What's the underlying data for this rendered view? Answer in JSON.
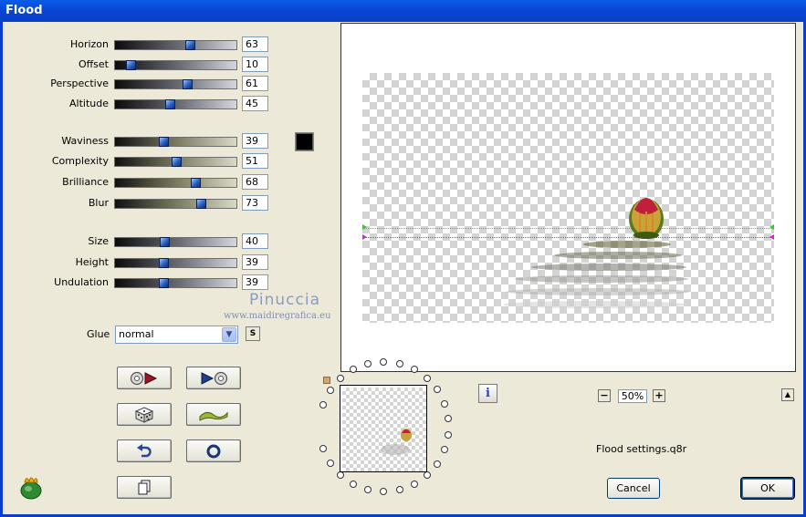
{
  "window": {
    "title": "Flood"
  },
  "sliders": [
    {
      "label": "Horizon",
      "value": 63
    },
    {
      "label": "Offset",
      "value": 10
    },
    {
      "label": "Perspective",
      "value": 61
    },
    {
      "label": "Altitude",
      "value": 45
    },
    {
      "label": "Waviness",
      "value": 39
    },
    {
      "label": "Complexity",
      "value": 51
    },
    {
      "label": "Brilliance",
      "value": 68
    },
    {
      "label": "Blur",
      "value": 73
    },
    {
      "label": "Size",
      "value": 40
    },
    {
      "label": "Height",
      "value": 39
    },
    {
      "label": "Undulation",
      "value": 39
    }
  ],
  "color_swatch": "#000000",
  "watermark": {
    "name": "Pinuccia",
    "url": "www.maidiregrafica.eu"
  },
  "glue": {
    "label": "Glue",
    "value": "normal"
  },
  "glue_side_button": "S",
  "tool_buttons": [
    {
      "icon": "random-left-icon"
    },
    {
      "icon": "random-right-icon"
    },
    {
      "icon": "dice-icon"
    },
    {
      "icon": "wave-icon"
    },
    {
      "icon": "undo-icon"
    },
    {
      "icon": "reset-icon"
    },
    {
      "icon": "copy-icon"
    }
  ],
  "info_button": "i",
  "zoom": {
    "minus": "−",
    "value": "50%",
    "plus": "+"
  },
  "expand_button": "▲",
  "settings_file": "Flood settings.q8r",
  "cancel_label": "Cancel",
  "ok_label": "OK",
  "colors": {
    "titlebar": "#0a4fd6",
    "dialog_bg": "#ece9d8",
    "horizon_green": "#2bd12b",
    "horizon_magenta": "#d623d6"
  }
}
